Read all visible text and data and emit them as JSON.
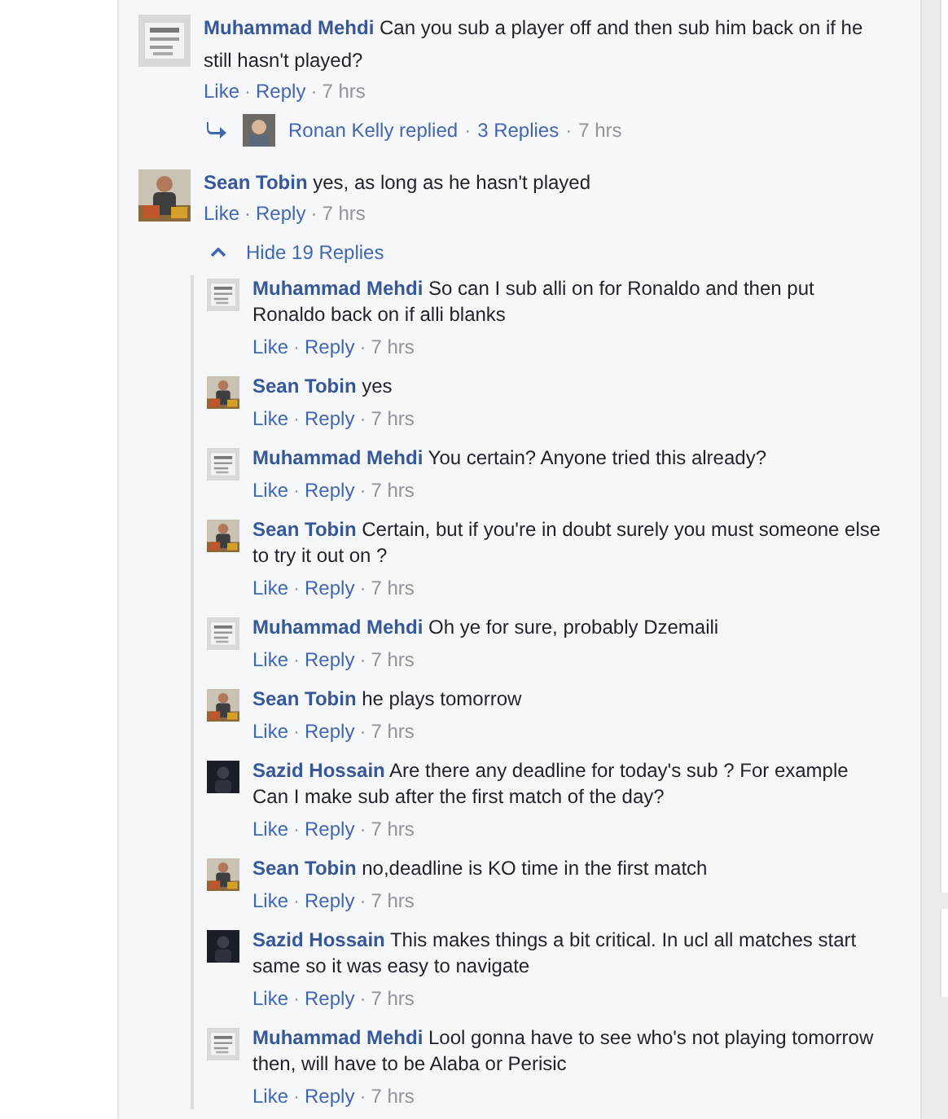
{
  "comments": [
    {
      "author": "Muhammad Mehdi",
      "text": "Can you sub a player off and then sub him back on if he still hasn't played?",
      "kind": "grey",
      "actions": [
        {
          "kind": "link",
          "text": "Like"
        },
        {
          "kind": "sep",
          "text": "·"
        },
        {
          "kind": "link",
          "text": "Reply"
        },
        {
          "kind": "sep",
          "text": "·"
        },
        {
          "kind": "time",
          "text": "7 hrs"
        }
      ],
      "reply_summary": [
        {
          "kind": "link",
          "text": "Ronan Kelly replied"
        },
        {
          "kind": "sep",
          "text": "·"
        },
        {
          "kind": "link",
          "text": "3 Replies"
        },
        {
          "kind": "sep",
          "text": "·"
        },
        {
          "kind": "time",
          "text": "7 hrs"
        }
      ]
    },
    {
      "author": "Sean Tobin",
      "text": "yes, as long as he hasn't played",
      "kind": "portrait",
      "actions": [
        {
          "kind": "link",
          "text": "Like"
        },
        {
          "kind": "sep",
          "text": "·"
        },
        {
          "kind": "link",
          "text": "Reply"
        },
        {
          "kind": "sep",
          "text": "·"
        },
        {
          "kind": "time",
          "text": "7 hrs"
        }
      ],
      "replies_toggle": "Hide 19 Replies",
      "replies": [
        {
          "author": "Muhammad Mehdi",
          "text": "So can I sub alli on for Ronaldo and then put Ronaldo back on if alli blanks",
          "kind": "grey",
          "actions": [
            {
              "kind": "link",
              "text": "Like"
            },
            {
              "kind": "sep",
              "text": "·"
            },
            {
              "kind": "link",
              "text": "Reply"
            },
            {
              "kind": "sep",
              "text": "·"
            },
            {
              "kind": "time",
              "text": "7 hrs"
            }
          ]
        },
        {
          "author": "Sean Tobin",
          "text": "yes",
          "kind": "portrait",
          "actions": [
            {
              "kind": "link",
              "text": "Like"
            },
            {
              "kind": "sep",
              "text": "·"
            },
            {
              "kind": "link",
              "text": "Reply"
            },
            {
              "kind": "sep",
              "text": "·"
            },
            {
              "kind": "time",
              "text": "7 hrs"
            }
          ]
        },
        {
          "author": "Muhammad Mehdi",
          "text": "You certain? Anyone tried this already?",
          "kind": "grey",
          "actions": [
            {
              "kind": "link",
              "text": "Like"
            },
            {
              "kind": "sep",
              "text": "·"
            },
            {
              "kind": "link",
              "text": "Reply"
            },
            {
              "kind": "sep",
              "text": "·"
            },
            {
              "kind": "time",
              "text": "7 hrs"
            }
          ]
        },
        {
          "author": "Sean Tobin",
          "text": "Certain, but if you're in doubt surely you must someone else to try it out on ?",
          "kind": "portrait",
          "actions": [
            {
              "kind": "link",
              "text": "Like"
            },
            {
              "kind": "sep",
              "text": "·"
            },
            {
              "kind": "link",
              "text": "Reply"
            },
            {
              "kind": "sep",
              "text": "·"
            },
            {
              "kind": "time",
              "text": "7 hrs"
            }
          ]
        },
        {
          "author": "Muhammad Mehdi",
          "text": "Oh ye for sure, probably Dzemaili",
          "kind": "grey",
          "actions": [
            {
              "kind": "link",
              "text": "Like"
            },
            {
              "kind": "sep",
              "text": "·"
            },
            {
              "kind": "link",
              "text": "Reply"
            },
            {
              "kind": "sep",
              "text": "·"
            },
            {
              "kind": "time",
              "text": "7 hrs"
            }
          ]
        },
        {
          "author": "Sean Tobin",
          "text": "he plays tomorrow",
          "kind": "portrait",
          "actions": [
            {
              "kind": "link",
              "text": "Like"
            },
            {
              "kind": "sep",
              "text": "·"
            },
            {
              "kind": "link",
              "text": "Reply"
            },
            {
              "kind": "sep",
              "text": "·"
            },
            {
              "kind": "time",
              "text": "7 hrs"
            }
          ]
        },
        {
          "author": "Sazid Hossain",
          "text": "Are there any deadline for today's sub ? For example Can I make sub after the first match of the day?",
          "kind": "dark",
          "actions": [
            {
              "kind": "link",
              "text": "Like"
            },
            {
              "kind": "sep",
              "text": "·"
            },
            {
              "kind": "link",
              "text": "Reply"
            },
            {
              "kind": "sep",
              "text": "·"
            },
            {
              "kind": "time",
              "text": "7 hrs"
            }
          ]
        },
        {
          "author": "Sean Tobin",
          "text": "no,deadline is KO time in the first match",
          "kind": "portrait",
          "actions": [
            {
              "kind": "link",
              "text": "Like"
            },
            {
              "kind": "sep",
              "text": "·"
            },
            {
              "kind": "link",
              "text": "Reply"
            },
            {
              "kind": "sep",
              "text": "·"
            },
            {
              "kind": "time",
              "text": "7 hrs"
            }
          ]
        },
        {
          "author": "Sazid Hossain",
          "text": "This makes things a bit critical. In ucl all matches start same so it was easy to navigate",
          "kind": "dark",
          "actions": [
            {
              "kind": "link",
              "text": "Like"
            },
            {
              "kind": "sep",
              "text": "·"
            },
            {
              "kind": "link",
              "text": "Reply"
            },
            {
              "kind": "sep",
              "text": "·"
            },
            {
              "kind": "time",
              "text": "7 hrs"
            }
          ]
        },
        {
          "author": "Muhammad Mehdi",
          "text": "Lool gonna have to see who's not playing tomorrow then, will have to be Alaba or Perisic",
          "kind": "grey",
          "actions": [
            {
              "kind": "link",
              "text": "Like"
            },
            {
              "kind": "sep",
              "text": "·"
            },
            {
              "kind": "link",
              "text": "Reply"
            },
            {
              "kind": "sep",
              "text": "·"
            },
            {
              "kind": "time",
              "text": "7 hrs"
            }
          ]
        }
      ]
    }
  ]
}
